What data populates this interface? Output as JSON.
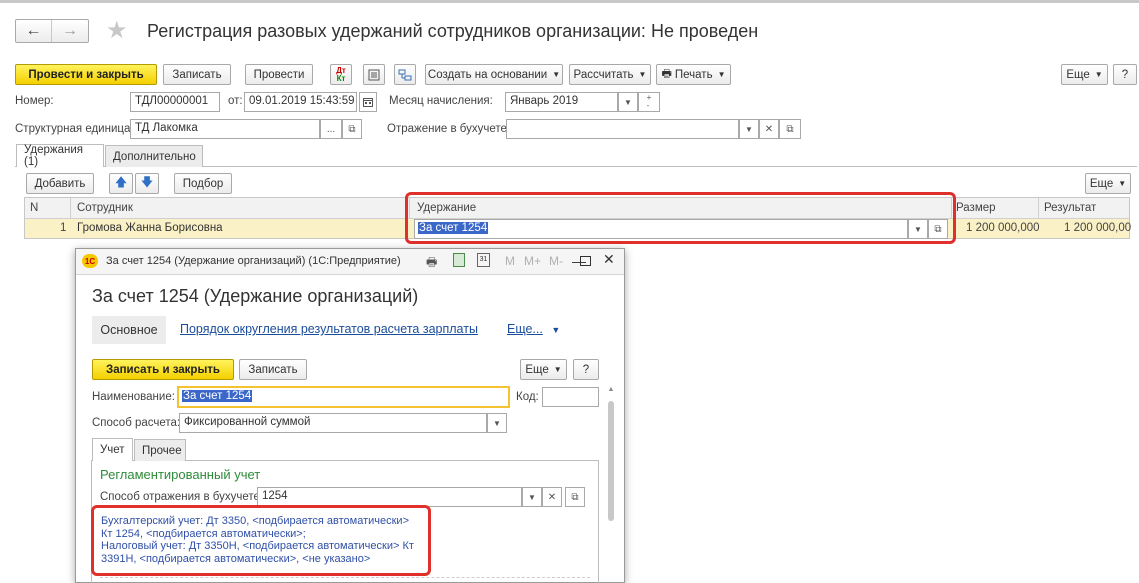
{
  "main": {
    "title": "Регистрация разовых удержаний сотрудников организации: Не проведен",
    "toolbar": {
      "post_close": "Провести и закрыть",
      "save": "Записать",
      "post": "Провести",
      "create_based": "Создать на основании",
      "calculate": "Рассчитать",
      "print": "Печать",
      "more": "Еще",
      "help": "?"
    },
    "fields": {
      "number_label": "Номер:",
      "number_value": "ТДЛ00000001",
      "date_label": "от:",
      "date_value": "09.01.2019 15:43:59",
      "month_label": "Месяц начисления:",
      "month_value": "Январь 2019",
      "unit_label": "Структурная единица:",
      "unit_value": "ТД Лакомка",
      "reflection_label": "Отражение в бухучете:",
      "reflection_value": ""
    },
    "tabs": [
      "Удержания (1)",
      "Дополнительно"
    ],
    "table_toolbar": {
      "add": "Добавить",
      "pick": "Подбор",
      "more": "Еще"
    },
    "table": {
      "columns": [
        "N",
        "Сотрудник",
        "Удержание",
        "Размер",
        "Результат"
      ],
      "rows": [
        {
          "n": "1",
          "employee": "Громова Жанна Борисовна",
          "deduction": "За счет 1254",
          "size": "1 200 000,000",
          "result": "1 200 000,00"
        }
      ]
    }
  },
  "dialog": {
    "window_title": "За счет 1254 (Удержание организаций) (1С:Предприятие)",
    "heading": "За счет 1254 (Удержание организаций)",
    "nav": {
      "main": "Основное",
      "rounding_link": "Порядок округления результатов расчета зарплаты",
      "more": "Еще..."
    },
    "toolbar": {
      "save_close": "Записать и закрыть",
      "save": "Записать",
      "more": "Еще",
      "help": "?"
    },
    "name_label": "Наименование:",
    "name_value": "За счет 1254",
    "code_label": "Код:",
    "code_value": "",
    "method_label": "Способ расчета:",
    "method_value": "Фиксированной суммой",
    "tabs": [
      "Учет",
      "Прочее"
    ],
    "section_title": "Регламентированный учет",
    "reflection_label": "Способ отражения в бухучете:",
    "reflection_value": "1254",
    "accounting_lines": [
      "Бухгалтерский учет: Дт 3350, <подбирается автоматически>",
      "Кт 1254, <подбирается автоматически>;",
      "Налоговый учет: Дт 3350Н, <подбирается автоматически> Кт",
      "3391Н, <подбирается автоматически>, <не указано>"
    ],
    "title_tools": [
      "M",
      "M+",
      "M-"
    ]
  },
  "colors": {
    "accent_yellow": "#f4d000",
    "highlight_red": "#e0302b",
    "link_blue": "#1a4d9c",
    "section_green": "#2e8b3a",
    "selection_blue": "#3b68c8",
    "row_highlight": "#fbf1c7"
  },
  "icons": [
    "back-arrow-icon",
    "forward-arrow-icon",
    "star-icon",
    "dt-kt-icon",
    "list-icon",
    "structure-icon",
    "printer-icon",
    "calendar-icon",
    "up-arrow-icon",
    "down-arrow-icon",
    "1c-logo-icon",
    "calculator-icon",
    "copy-icon",
    "minimize-icon",
    "maximize-icon",
    "close-icon"
  ]
}
